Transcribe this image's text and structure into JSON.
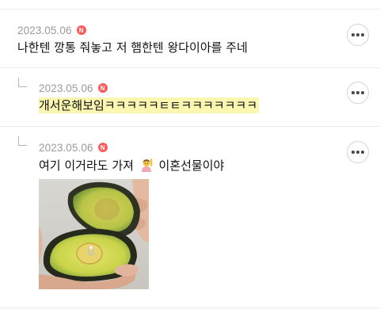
{
  "comments": [
    {
      "date": "2023.05.06",
      "badge": "N",
      "text": "나한텐 깡통 줘놓고 저 햄한텐 왕다이아를 주네",
      "is_reply": false
    },
    {
      "date": "2023.05.06",
      "badge": "N",
      "text": "개서운해보임ㅋㅋㅋㅋㅋㅌㅌㅋㅋㅋㅋㅋㅋㅋ",
      "is_reply": true,
      "highlighted": true
    },
    {
      "date": "2023.05.06",
      "badge": "N",
      "text_before": "여기 이거라도 가져",
      "emoji_icon": "person-raising-hand-emoji",
      "text_after": "이혼선물이야",
      "is_reply": true,
      "attachment_icon": "avocado-ring-photo"
    }
  ],
  "colors": {
    "date": "#9a9a9a",
    "badge": "#ff5a5a",
    "highlight": "#fbf6b0",
    "divider": "#ececec"
  },
  "icons": [
    "new-badge-icon",
    "reply-arrow-icon",
    "more-options-icon",
    "person-raising-hand-emoji"
  ]
}
